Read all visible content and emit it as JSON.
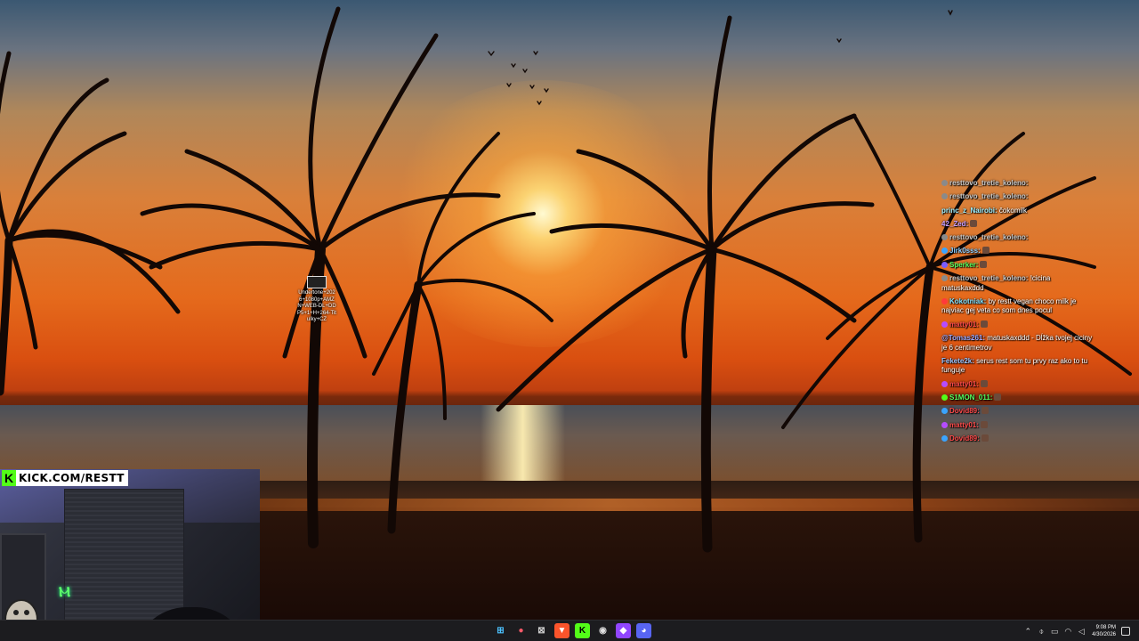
{
  "desktop": {
    "icon_label": "Undertone+2026+1080p+AMZN+WEB-DL+DDP5+1+H+264-Titulky+CZ"
  },
  "stream": {
    "kick_banner": "KICK.COM/RESTT"
  },
  "chat": {
    "messages": [
      {
        "user": "resttovo_tretie_koleno:",
        "text": "",
        "badge_color": "#8a8a8a",
        "user_color": "#c9c9c9"
      },
      {
        "user": "resttovo_tretie_koleno:",
        "text": "",
        "badge_color": "#8a8a8a",
        "user_color": "#c9c9c9"
      },
      {
        "user": "princ_z_Nairobi:",
        "text": "čokomilk",
        "badge_color": "",
        "user_color": "#9ff0ff"
      },
      {
        "user": "42_Zed:",
        "text": "",
        "badge_color": "",
        "user_color": "#c79cff",
        "emote": true
      },
      {
        "user": "resttovo_tretie_koleno:",
        "text": "",
        "badge_color": "#8a8a8a",
        "user_color": "#c9c9c9"
      },
      {
        "user": "Jirk0sss:",
        "text": "",
        "badge_color": "#3aa4ff",
        "user_color": "#8fd0ff",
        "emote": true
      },
      {
        "user": "Sperker:",
        "text": "",
        "badge_color": "#7a5cff",
        "user_color": "#54ff5f",
        "emote": true
      },
      {
        "user": "resttovo_tretie_koleno:",
        "text": "!cicina matuskaxddd",
        "badge_color": "#8a8a8a",
        "user_color": "#c9c9c9"
      },
      {
        "user": "Kokotniak:",
        "text": "by restt vegan choco milk je najviac gej veta co som dnes pocul",
        "badge_color": "#ff3a3a",
        "user_color": "#7fe0ff"
      },
      {
        "user": "matty01:",
        "text": "",
        "badge_color": "#b54cff",
        "user_color": "#ff4a4a",
        "emote": true
      },
      {
        "user": "@Tomas261:",
        "text": "matuskaxddd - Dĺžka tvojej ciciny je 6 centimetrov",
        "badge_color": "",
        "user_color": "#9aa8ff"
      },
      {
        "user": "Fekete2k:",
        "text": "serus rest som tu prvy raz ako to tu funguje",
        "badge_color": "",
        "user_color": "#9ac4ff"
      },
      {
        "user": "matty01:",
        "text": "",
        "badge_color": "#b54cff",
        "user_color": "#ff4a4a",
        "emote": true
      },
      {
        "user": "S1MON_011:",
        "text": "",
        "badge_color": "#53fc18",
        "user_color": "#54ff5f",
        "emote": true
      },
      {
        "user": "Dovid89:",
        "text": "",
        "badge_color": "#3aa4ff",
        "user_color": "#ff4a4a",
        "emote": true
      },
      {
        "user": "matty01:",
        "text": "",
        "badge_color": "#b54cff",
        "user_color": "#ff4a4a",
        "emote": true
      },
      {
        "user": "Dovid89:",
        "text": "",
        "badge_color": "#3aa4ff",
        "user_color": "#ff4a4a",
        "emote": true
      }
    ]
  },
  "taskbar": {
    "apps": [
      {
        "name": "start-button",
        "glyph": "⊞",
        "bg": "#1c1c1f",
        "color": "#4cc2ff"
      },
      {
        "name": "maps-icon",
        "glyph": "●",
        "bg": "#1c1c1f",
        "color": "#ff5a6a"
      },
      {
        "name": "xbox-icon",
        "glyph": "⊠",
        "bg": "#1c1c1f",
        "color": "#cfcfcf"
      },
      {
        "name": "brave-icon",
        "glyph": "▼",
        "bg": "#fb542b",
        "color": "#fff"
      },
      {
        "name": "kick-icon",
        "glyph": "K",
        "bg": "#53fc18",
        "color": "#000"
      },
      {
        "name": "obs-icon",
        "glyph": "◉",
        "bg": "#1c1c1f",
        "color": "#e0e0e0"
      },
      {
        "name": "twitch-icon",
        "glyph": "◆",
        "bg": "#9146ff",
        "color": "#fff"
      },
      {
        "name": "discord-icon",
        "glyph": "◕",
        "bg": "#5865f2",
        "color": "#fff"
      }
    ],
    "time": "9:08 PM",
    "date": "4/30/2026"
  }
}
